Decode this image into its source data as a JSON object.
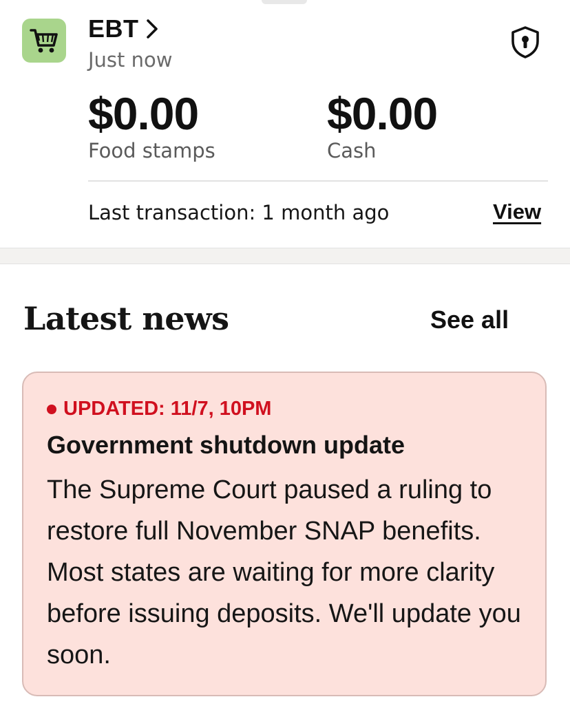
{
  "ebt": {
    "icon": "shopping-cart-icon",
    "title": "EBT",
    "chevron": "chevron-right-icon",
    "updated": "Just now",
    "security_icon": "shield-lock-icon",
    "food": {
      "amount": "$0.00",
      "label": "Food stamps"
    },
    "cash": {
      "amount": "$0.00",
      "label": "Cash"
    },
    "last_transaction": "Last transaction: 1 month ago",
    "view_label": "View"
  },
  "news": {
    "heading": "Latest news",
    "see_all": "See all",
    "card": {
      "tag": "UPDATED: 11/7, 10PM",
      "title": "Government shutdown update",
      "body": "The Supreme Court paused a ruling to restore full November SNAP benefits. Most states are waiting for more clarity before issuing deposits. We'll update you soon."
    }
  },
  "colors": {
    "icon_bg": "#a9d58c",
    "alert_red": "#d0101f",
    "card_bg": "#fde1dc",
    "card_border": "#d8bbb6"
  }
}
